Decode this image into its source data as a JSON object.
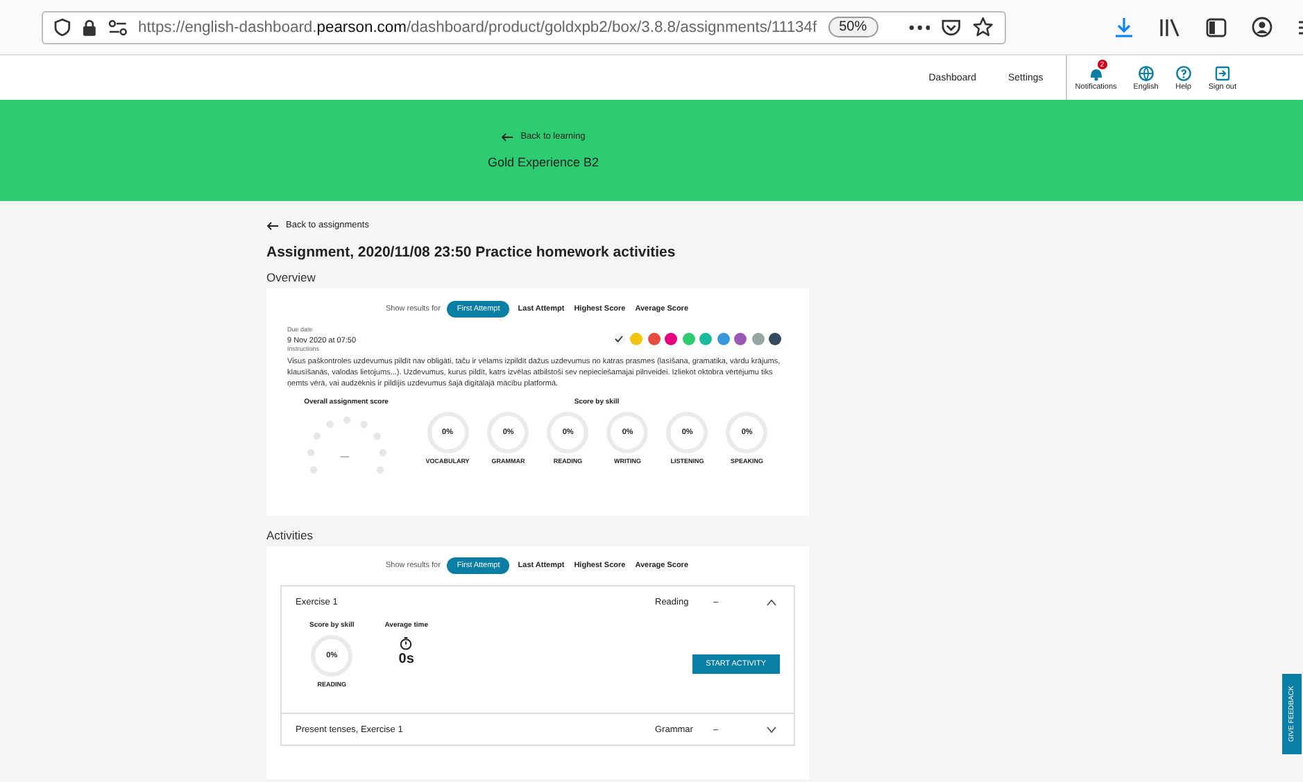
{
  "browser": {
    "url_prefix": "https://english-dashboard.",
    "url_domain": "pearson.com",
    "url_path": "/dashboard/product/goldxpb2/box/3.8.8/assignments/11134f",
    "zoom": "50%"
  },
  "nav": {
    "links": [
      "Dashboard",
      "Settings"
    ],
    "actions": [
      {
        "label": "Notifications",
        "kind": "bell",
        "badge": "2"
      },
      {
        "label": "English",
        "kind": "globe"
      },
      {
        "label": "Help",
        "kind": "help"
      },
      {
        "label": "Sign out",
        "kind": "signout"
      }
    ]
  },
  "header": {
    "back": "Back to learning",
    "title": "Gold Experience B2"
  },
  "back": "Back to assignments",
  "title": "Assignment, 2020/11/08 23:50 Practice homework activities",
  "overview": {
    "heading": "Overview",
    "filter": {
      "label": "Show results for",
      "options": [
        {
          "label": "First Attempt",
          "selected": true
        },
        {
          "label": "Last Attempt",
          "selected": false
        },
        {
          "label": "Highest Score",
          "selected": false
        },
        {
          "label": "Average Score",
          "selected": false
        }
      ]
    },
    "due_label": "Due date",
    "due_value": "9 Nov 2020 at 07:50",
    "colors": [
      {
        "color": "#f4f4f4",
        "selected": true
      },
      {
        "color": "#f1c40f",
        "selected": false
      },
      {
        "color": "#e74c3c",
        "selected": false
      },
      {
        "color": "#e6007e",
        "selected": false
      },
      {
        "color": "#2ecc71",
        "selected": false
      },
      {
        "color": "#1abc9c",
        "selected": false
      },
      {
        "color": "#3498db",
        "selected": false
      },
      {
        "color": "#9b59b6",
        "selected": false
      },
      {
        "color": "#95a5a6",
        "selected": false
      },
      {
        "color": "#34495e",
        "selected": false
      }
    ],
    "instructions_label": "Instructions",
    "instructions": "Visus paškontroles uzdevumus pildīt nav obligāti, taču ir vēlams izpildīt dažus uzdevumus no katras prasmes (lasīšana, gramatika, vārdu krājums, klausīšanās, valodas lietojums...). Uzdevumus, kurus pildīt, katrs izvēlas atbilstoši sev nepieciešamajai pilnveidei. Izliekot oktobra vērtējumu tiks ņemts vērā, vai audzēknis ir pildījis uzdevumus šajā digitālajā mācību platformā.",
    "overall_label": "Overall assignment score",
    "overall_value": "—",
    "skills_label": "Score by skill",
    "skills": [
      {
        "value": "0%",
        "name": "VOCABULARY"
      },
      {
        "value": "0%",
        "name": "GRAMMAR"
      },
      {
        "value": "0%",
        "name": "READING"
      },
      {
        "value": "0%",
        "name": "WRITING"
      },
      {
        "value": "0%",
        "name": "LISTENING"
      },
      {
        "value": "0%",
        "name": "SPEAKING"
      }
    ]
  },
  "activities": {
    "heading": "Activities",
    "filter": {
      "label": "Show results for",
      "options": [
        {
          "label": "First Attempt",
          "selected": true
        },
        {
          "label": "Last Attempt",
          "selected": false
        },
        {
          "label": "Highest Score",
          "selected": false
        },
        {
          "label": "Average Score",
          "selected": false
        }
      ]
    },
    "exercises": [
      {
        "title": "Exercise 1",
        "skill": "Reading",
        "score": "–",
        "expanded": true,
        "skill_label": "Score by skill",
        "skill_value": "0%",
        "skill_name": "READING",
        "time_label": "Average time",
        "time_value": "0s",
        "button": "START ACTIVITY"
      },
      {
        "title": "Present tenses, Exercise 1",
        "skill": "Grammar",
        "score": "–",
        "expanded": false
      }
    ]
  },
  "feedback": "GIVE FEEDBACK"
}
